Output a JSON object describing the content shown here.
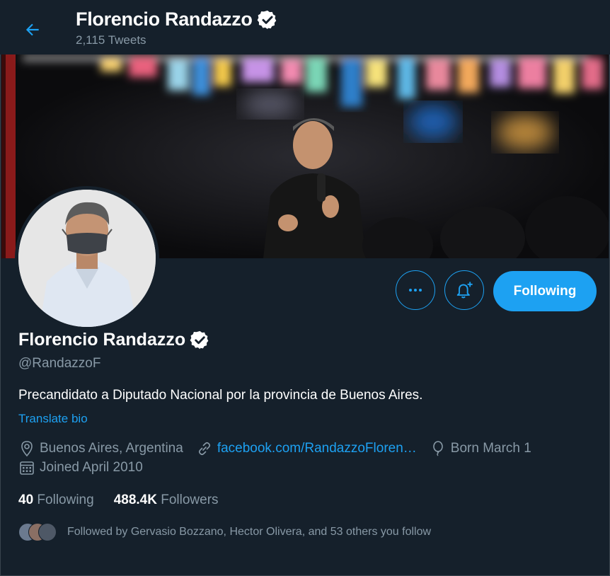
{
  "header": {
    "title": "Florencio Randazzo",
    "tweets_count": "2,115 Tweets"
  },
  "profile": {
    "name": "Florencio Randazzo",
    "handle": "@RandazzoF",
    "bio": "Precandidato a Diputado Nacional por la provincia de Buenos Aires.",
    "translate_label": "Translate bio",
    "location": "Buenos Aires, Argentina",
    "website": "facebook.com/RandazzoFloren…",
    "birthday": "Born March 1",
    "joined": "Joined April 2010",
    "following_count": "40",
    "following_label": "Following",
    "followers_count": "488.4K",
    "followers_label": "Followers",
    "followed_by": "Followed by Gervasio Bozzano, Hector Olivera, and 53 others you follow"
  },
  "actions": {
    "more_icon": "more-icon",
    "notify_icon": "notification-bell-plus-icon",
    "following_button": "Following"
  },
  "colors": {
    "background": "#15202b",
    "accent": "#1da1f2",
    "secondary_text": "#8899a6",
    "border": "#38444d"
  }
}
